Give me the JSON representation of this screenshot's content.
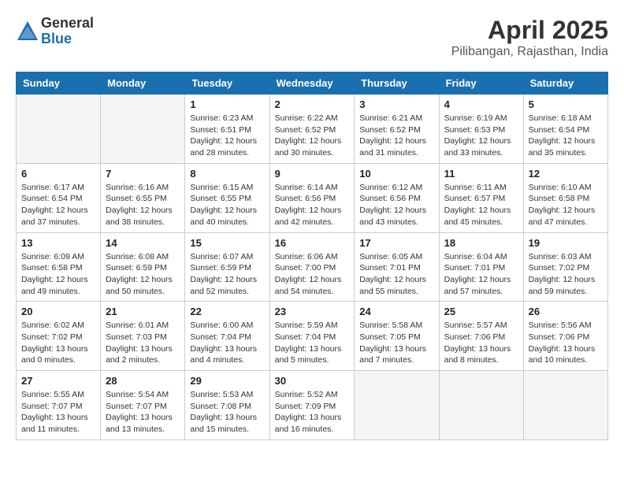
{
  "logo": {
    "general": "General",
    "blue": "Blue"
  },
  "title": "April 2025",
  "subtitle": "Pilibangan, Rajasthan, India",
  "days_of_week": [
    "Sunday",
    "Monday",
    "Tuesday",
    "Wednesday",
    "Thursday",
    "Friday",
    "Saturday"
  ],
  "weeks": [
    [
      {
        "day": "",
        "info": ""
      },
      {
        "day": "",
        "info": ""
      },
      {
        "day": "1",
        "info": "Sunrise: 6:23 AM\nSunset: 6:51 PM\nDaylight: 12 hours and 28 minutes."
      },
      {
        "day": "2",
        "info": "Sunrise: 6:22 AM\nSunset: 6:52 PM\nDaylight: 12 hours and 30 minutes."
      },
      {
        "day": "3",
        "info": "Sunrise: 6:21 AM\nSunset: 6:52 PM\nDaylight: 12 hours and 31 minutes."
      },
      {
        "day": "4",
        "info": "Sunrise: 6:19 AM\nSunset: 6:53 PM\nDaylight: 12 hours and 33 minutes."
      },
      {
        "day": "5",
        "info": "Sunrise: 6:18 AM\nSunset: 6:54 PM\nDaylight: 12 hours and 35 minutes."
      }
    ],
    [
      {
        "day": "6",
        "info": "Sunrise: 6:17 AM\nSunset: 6:54 PM\nDaylight: 12 hours and 37 minutes."
      },
      {
        "day": "7",
        "info": "Sunrise: 6:16 AM\nSunset: 6:55 PM\nDaylight: 12 hours and 38 minutes."
      },
      {
        "day": "8",
        "info": "Sunrise: 6:15 AM\nSunset: 6:55 PM\nDaylight: 12 hours and 40 minutes."
      },
      {
        "day": "9",
        "info": "Sunrise: 6:14 AM\nSunset: 6:56 PM\nDaylight: 12 hours and 42 minutes."
      },
      {
        "day": "10",
        "info": "Sunrise: 6:12 AM\nSunset: 6:56 PM\nDaylight: 12 hours and 43 minutes."
      },
      {
        "day": "11",
        "info": "Sunrise: 6:11 AM\nSunset: 6:57 PM\nDaylight: 12 hours and 45 minutes."
      },
      {
        "day": "12",
        "info": "Sunrise: 6:10 AM\nSunset: 6:58 PM\nDaylight: 12 hours and 47 minutes."
      }
    ],
    [
      {
        "day": "13",
        "info": "Sunrise: 6:09 AM\nSunset: 6:58 PM\nDaylight: 12 hours and 49 minutes."
      },
      {
        "day": "14",
        "info": "Sunrise: 6:08 AM\nSunset: 6:59 PM\nDaylight: 12 hours and 50 minutes."
      },
      {
        "day": "15",
        "info": "Sunrise: 6:07 AM\nSunset: 6:59 PM\nDaylight: 12 hours and 52 minutes."
      },
      {
        "day": "16",
        "info": "Sunrise: 6:06 AM\nSunset: 7:00 PM\nDaylight: 12 hours and 54 minutes."
      },
      {
        "day": "17",
        "info": "Sunrise: 6:05 AM\nSunset: 7:01 PM\nDaylight: 12 hours and 55 minutes."
      },
      {
        "day": "18",
        "info": "Sunrise: 6:04 AM\nSunset: 7:01 PM\nDaylight: 12 hours and 57 minutes."
      },
      {
        "day": "19",
        "info": "Sunrise: 6:03 AM\nSunset: 7:02 PM\nDaylight: 12 hours and 59 minutes."
      }
    ],
    [
      {
        "day": "20",
        "info": "Sunrise: 6:02 AM\nSunset: 7:02 PM\nDaylight: 13 hours and 0 minutes."
      },
      {
        "day": "21",
        "info": "Sunrise: 6:01 AM\nSunset: 7:03 PM\nDaylight: 13 hours and 2 minutes."
      },
      {
        "day": "22",
        "info": "Sunrise: 6:00 AM\nSunset: 7:04 PM\nDaylight: 13 hours and 4 minutes."
      },
      {
        "day": "23",
        "info": "Sunrise: 5:59 AM\nSunset: 7:04 PM\nDaylight: 13 hours and 5 minutes."
      },
      {
        "day": "24",
        "info": "Sunrise: 5:58 AM\nSunset: 7:05 PM\nDaylight: 13 hours and 7 minutes."
      },
      {
        "day": "25",
        "info": "Sunrise: 5:57 AM\nSunset: 7:06 PM\nDaylight: 13 hours and 8 minutes."
      },
      {
        "day": "26",
        "info": "Sunrise: 5:56 AM\nSunset: 7:06 PM\nDaylight: 13 hours and 10 minutes."
      }
    ],
    [
      {
        "day": "27",
        "info": "Sunrise: 5:55 AM\nSunset: 7:07 PM\nDaylight: 13 hours and 11 minutes."
      },
      {
        "day": "28",
        "info": "Sunrise: 5:54 AM\nSunset: 7:07 PM\nDaylight: 13 hours and 13 minutes."
      },
      {
        "day": "29",
        "info": "Sunrise: 5:53 AM\nSunset: 7:08 PM\nDaylight: 13 hours and 15 minutes."
      },
      {
        "day": "30",
        "info": "Sunrise: 5:52 AM\nSunset: 7:09 PM\nDaylight: 13 hours and 16 minutes."
      },
      {
        "day": "",
        "info": ""
      },
      {
        "day": "",
        "info": ""
      },
      {
        "day": "",
        "info": ""
      }
    ]
  ]
}
